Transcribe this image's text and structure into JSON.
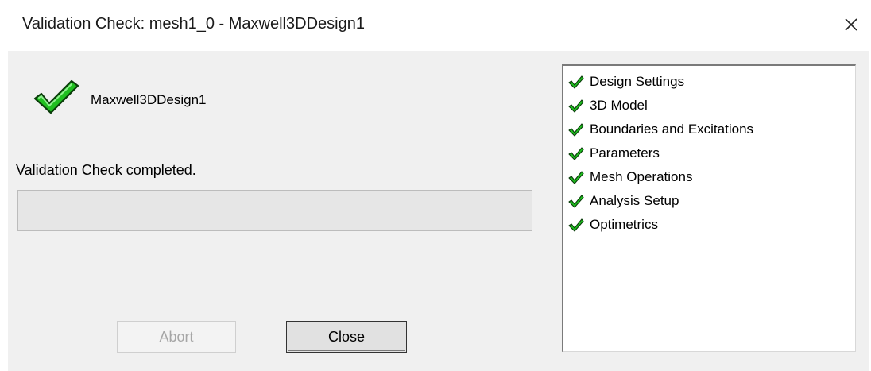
{
  "window": {
    "title": "Validation Check: mesh1_0 - Maxwell3DDesign1",
    "close_glyph": "×"
  },
  "design": {
    "name": "Maxwell3DDesign1",
    "status_icon": "checkmark-icon",
    "check_color": "#1fbf1f"
  },
  "status": {
    "message": "Validation Check completed.",
    "progress_percent": 0
  },
  "buttons": {
    "abort_label": "Abort",
    "abort_enabled": false,
    "close_label": "Close"
  },
  "checklist": {
    "items": [
      {
        "label": "Design Settings",
        "icon": "checkmark-icon"
      },
      {
        "label": "3D Model",
        "icon": "checkmark-icon"
      },
      {
        "label": "Boundaries and Excitations",
        "icon": "checkmark-icon"
      },
      {
        "label": "Parameters",
        "icon": "checkmark-icon"
      },
      {
        "label": "Mesh Operations",
        "icon": "checkmark-icon"
      },
      {
        "label": "Analysis Setup",
        "icon": "checkmark-icon"
      },
      {
        "label": "Optimetrics",
        "icon": "checkmark-icon"
      }
    ]
  }
}
